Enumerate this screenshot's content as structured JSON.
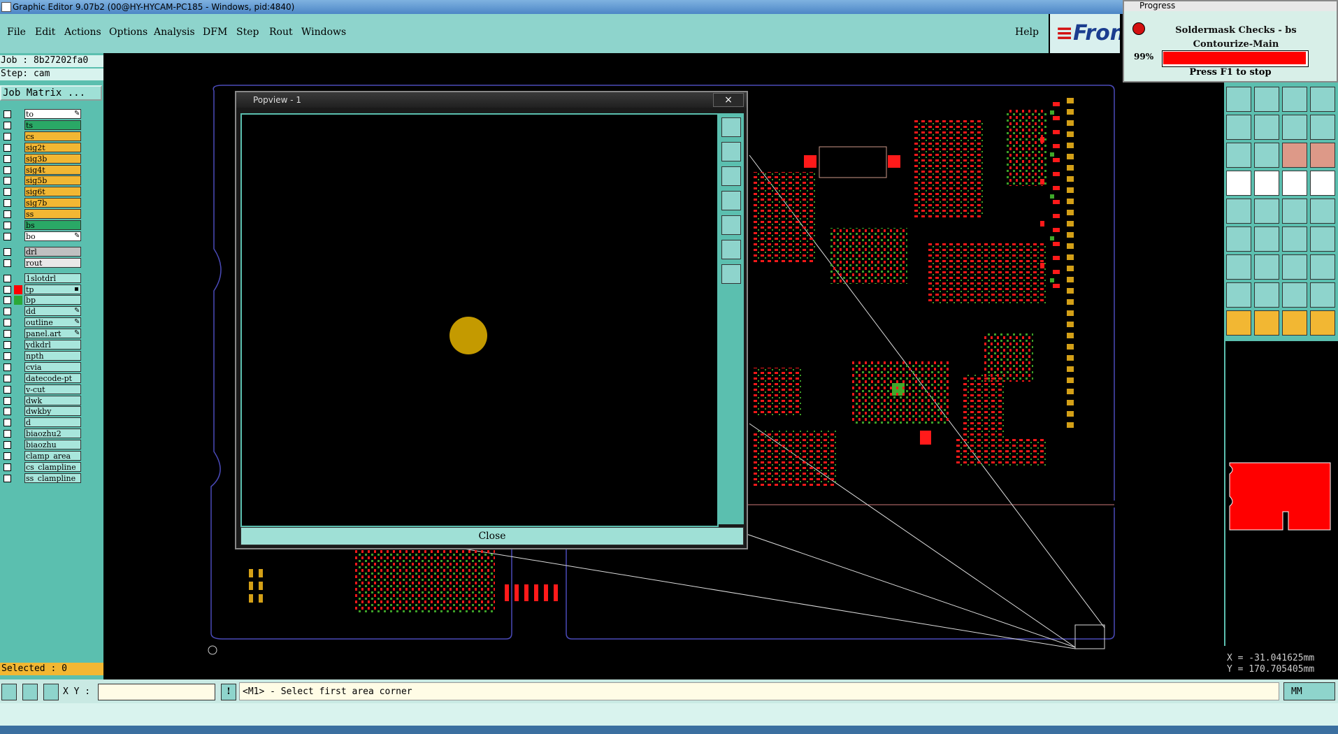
{
  "window": {
    "title": "Graphic Editor 9.07b2 (00@HY-HYCAM-PC185 - Windows, pid:4840)"
  },
  "menu": [
    "File",
    "Edit",
    "Actions",
    "Options",
    "Analysis",
    "DFM",
    "Step",
    "Rout",
    "Windows"
  ],
  "help": "Help",
  "brand": {
    "text": "Front"
  },
  "job": {
    "job_line": "Job : 8b27202fa0",
    "step_line": "Step: cam",
    "matrix_button": "Job Matrix ..."
  },
  "layers": [
    {
      "name": "to",
      "color": "#ffffff",
      "swatch": "",
      "mark": "✎"
    },
    {
      "name": "ts",
      "color": "#2aa866",
      "swatch": "",
      "mark": ""
    },
    {
      "name": "cs",
      "color": "#f2b733",
      "swatch": "",
      "mark": ""
    },
    {
      "name": "sig2t",
      "color": "#f2b733",
      "swatch": "",
      "mark": ""
    },
    {
      "name": "sig3b",
      "color": "#f2b733",
      "swatch": "",
      "mark": ""
    },
    {
      "name": "sig4t",
      "color": "#f2b733",
      "swatch": "",
      "mark": ""
    },
    {
      "name": "sig5b",
      "color": "#f2b733",
      "swatch": "",
      "mark": ""
    },
    {
      "name": "sig6t",
      "color": "#f2b733",
      "swatch": "",
      "mark": ""
    },
    {
      "name": "sig7b",
      "color": "#f2b733",
      "swatch": "",
      "mark": ""
    },
    {
      "name": "ss",
      "color": "#f2b733",
      "swatch": "",
      "mark": ""
    },
    {
      "name": "bs",
      "color": "#2aa866",
      "swatch": "",
      "mark": ""
    },
    {
      "name": "bo",
      "color": "#ffffff",
      "swatch": "",
      "mark": "✎"
    },
    {
      "name": "drl",
      "color": "#c0c0c0",
      "swatch": "",
      "mark": ""
    },
    {
      "name": "rout",
      "color": "#e8e8e8",
      "swatch": "",
      "mark": ""
    },
    {
      "name": "1slotdrl",
      "color": "#a8e6dc",
      "swatch": "",
      "mark": ""
    },
    {
      "name": "tp",
      "color": "#a8e6dc",
      "swatch": "#ff0000",
      "mark": "▪"
    },
    {
      "name": "bp",
      "color": "#a8e6dc",
      "swatch": "#2aa838",
      "mark": ""
    },
    {
      "name": "dd",
      "color": "#a8e6dc",
      "swatch": "",
      "mark": "✎"
    },
    {
      "name": "outline",
      "color": "#a8e6dc",
      "swatch": "",
      "mark": "✎"
    },
    {
      "name": "panel.art",
      "color": "#a8e6dc",
      "swatch": "",
      "mark": "✎"
    },
    {
      "name": "ydkdrl",
      "color": "#a8e6dc",
      "swatch": "",
      "mark": ""
    },
    {
      "name": "npth",
      "color": "#a8e6dc",
      "swatch": "",
      "mark": ""
    },
    {
      "name": "cvia",
      "color": "#a8e6dc",
      "swatch": "",
      "mark": ""
    },
    {
      "name": "datecode-pt",
      "color": "#a8e6dc",
      "swatch": "",
      "mark": ""
    },
    {
      "name": "v-cut",
      "color": "#a8e6dc",
      "swatch": "",
      "mark": ""
    },
    {
      "name": "dwk",
      "color": "#a8e6dc",
      "swatch": "",
      "mark": ""
    },
    {
      "name": "dwkby",
      "color": "#a8e6dc",
      "swatch": "",
      "mark": ""
    },
    {
      "name": "d",
      "color": "#a8e6dc",
      "swatch": "",
      "mark": ""
    },
    {
      "name": "biaozhu2",
      "color": "#a8e6dc",
      "swatch": "",
      "mark": ""
    },
    {
      "name": "biaozhu",
      "color": "#a8e6dc",
      "swatch": "",
      "mark": ""
    },
    {
      "name": "clamp_area",
      "color": "#a8e6dc",
      "swatch": "",
      "mark": ""
    },
    {
      "name": "cs_clampline",
      "color": "#a8e6dc",
      "swatch": "",
      "mark": ""
    },
    {
      "name": "ss_clampline",
      "color": "#a8e6dc",
      "swatch": "",
      "mark": ""
    }
  ],
  "selected": "Selected : 0",
  "popview": {
    "title": "Popview - 1",
    "close_x": "×",
    "close_button": "Close"
  },
  "progress": {
    "title": "Progress",
    "line1": "Soldermask Checks - bs",
    "line2": "Contourize-Main",
    "percent_label": "99%",
    "percent": 0.99,
    "stop_hint": "Press F1 to stop"
  },
  "coords": {
    "x": "X = -31.041625mm",
    "y": "Y = 170.705405mm"
  },
  "bottom": {
    "xy_label": "X Y :",
    "prompt": "<M1> - Select first area corner",
    "units": "MM"
  },
  "colors": {
    "red_pad": "#ff1a1a",
    "green_pad": "#3fa82a",
    "gold_pad": "#d4a017",
    "outline_blue": "#4a4ab8",
    "panel_teal": "#5bbfaf",
    "selected_layer": "#2aa866"
  }
}
